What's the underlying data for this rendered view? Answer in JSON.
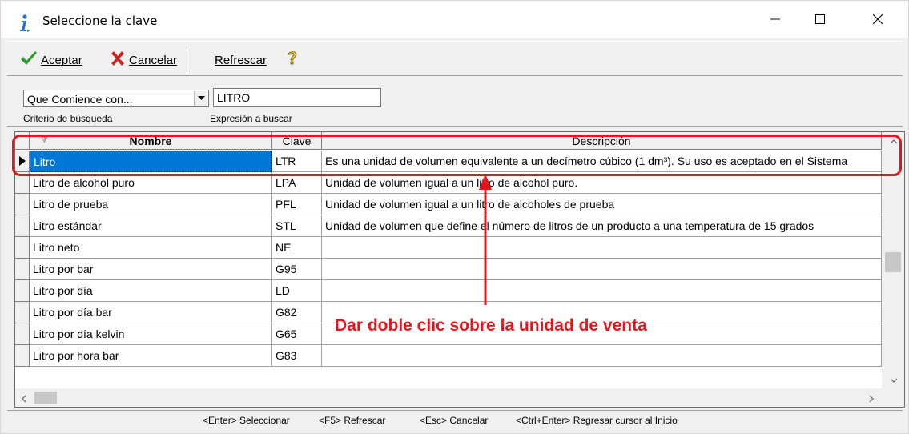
{
  "window": {
    "title": "Seleccione la clave",
    "icon": "info-icon"
  },
  "toolbar": {
    "accept_label": "Aceptar",
    "cancel_label": "Cancelar",
    "refresh_label": "Refrescar",
    "help_icon": "help-question-icon"
  },
  "search": {
    "criteria_value": "Que Comience con...",
    "criteria_label": "Criterio de búsqueda",
    "expression_value": "LITRO",
    "expression_label": "Expresión a buscar"
  },
  "grid": {
    "columns": [
      "Nombre",
      "Clave",
      "Descripción"
    ],
    "rows": [
      {
        "nombre": "Litro",
        "clave": "LTR",
        "descripcion": "Es una unidad de volumen equivalente a un decímetro cúbico (1 dm³). Su uso es aceptado en el Sistema"
      },
      {
        "nombre": "Litro de alcohol puro",
        "clave": "LPA",
        "descripcion": "Unidad de volumen igual a un litro de alcohol puro."
      },
      {
        "nombre": "Litro de prueba",
        "clave": "PFL",
        "descripcion": "Unidad de volumen igual a un litro de alcoholes de prueba"
      },
      {
        "nombre": "Litro estándar",
        "clave": "STL",
        "descripcion": "Unidad de volumen que define el número de litros de un producto a una temperatura de 15 grados"
      },
      {
        "nombre": "Litro neto",
        "clave": "NE",
        "descripcion": ""
      },
      {
        "nombre": "Litro por bar",
        "clave": "G95",
        "descripcion": ""
      },
      {
        "nombre": "Litro por día",
        "clave": "LD",
        "descripcion": ""
      },
      {
        "nombre": "Litro por día bar",
        "clave": "G82",
        "descripcion": ""
      },
      {
        "nombre": "Litro por día kelvin",
        "clave": "G65",
        "descripcion": ""
      },
      {
        "nombre": "Litro por hora bar",
        "clave": "G83",
        "descripcion": ""
      }
    ],
    "selected_row": 0
  },
  "statusbar": {
    "items": [
      "<Enter> Seleccionar",
      "<F5> Refrescar",
      "<Esc> Cancelar",
      "<Ctrl+Enter> Regresar cursor al Inicio"
    ]
  },
  "annotation": {
    "text": "Dar doble clic sobre la unidad de venta",
    "color": "#e8141c"
  },
  "colors": {
    "selection": "#0078d7",
    "accept_icon": "#2e9a2e",
    "cancel_icon": "#d41f1f"
  }
}
